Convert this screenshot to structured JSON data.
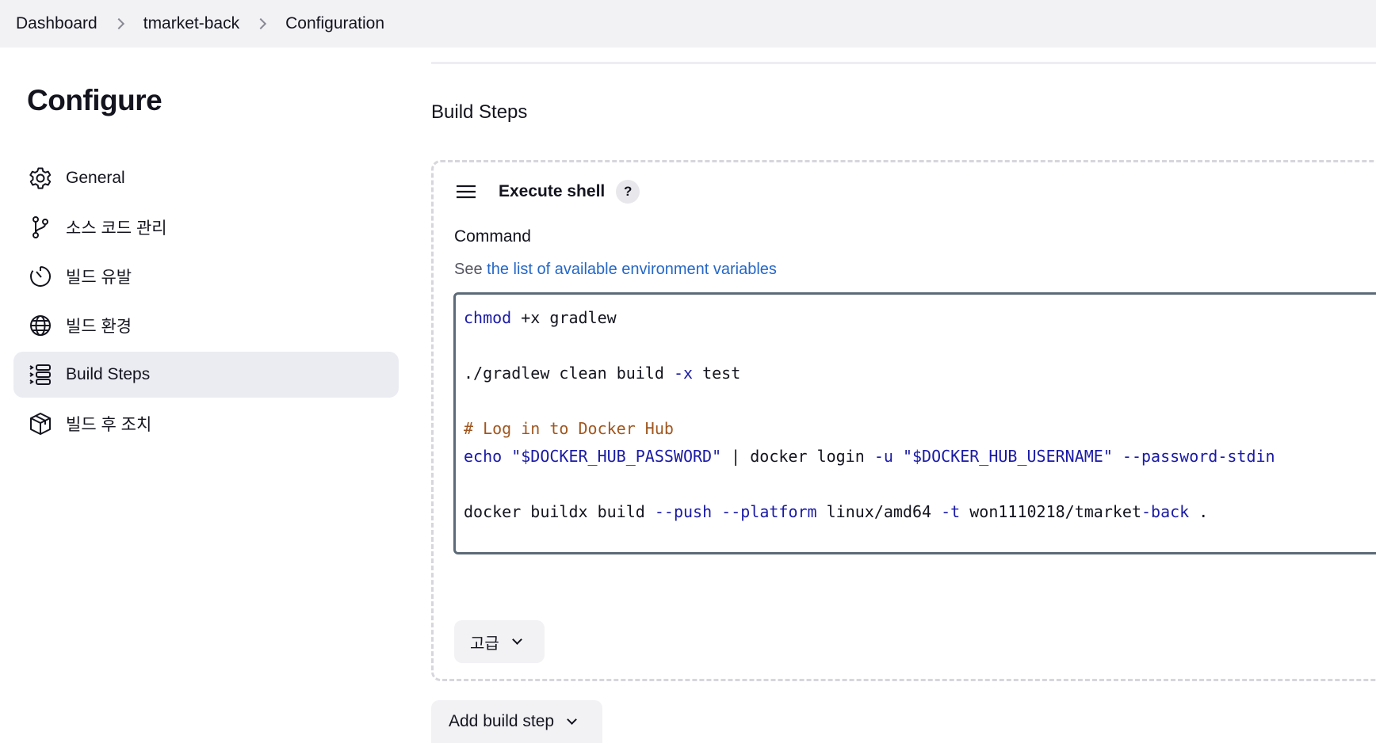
{
  "breadcrumb": [
    "Dashboard",
    "tmarket-back",
    "Configuration"
  ],
  "sidebar": {
    "title": "Configure",
    "items": [
      {
        "label": "General",
        "icon": "gear-icon"
      },
      {
        "label": "소스 코드 관리",
        "icon": "branch-icon"
      },
      {
        "label": "빌드 유발",
        "icon": "timer-icon"
      },
      {
        "label": "빌드 환경",
        "icon": "globe-icon"
      },
      {
        "label": "Build Steps",
        "icon": "list-icon",
        "active": true
      },
      {
        "label": "빌드 후 조치",
        "icon": "package-icon"
      }
    ]
  },
  "main": {
    "section_title": "Build Steps",
    "step": {
      "name": "Execute shell",
      "help": "?",
      "command_label": "Command",
      "hint_prefix": "See ",
      "hint_link": "the list of available environment variables",
      "code_lines": [
        "chmod +x gradlew",
        "",
        "./gradlew clean build -x test",
        "",
        "# Log in to Docker Hub",
        "echo \"$DOCKER_HUB_PASSWORD\" | docker login -u \"$DOCKER_HUB_USERNAME\" --password-stdin",
        "",
        "docker buildx build --push --platform linux/amd64 -t won1110218/tmarket-back ."
      ],
      "advanced_label": "고급"
    },
    "add_step_label": "Add build step"
  },
  "colors": {
    "topbar_bg": "#f2f2f5",
    "active_nav_bg": "#ebecf2",
    "link": "#2567c7",
    "keyword": "#1a1aa6",
    "comment": "#a0561e"
  }
}
